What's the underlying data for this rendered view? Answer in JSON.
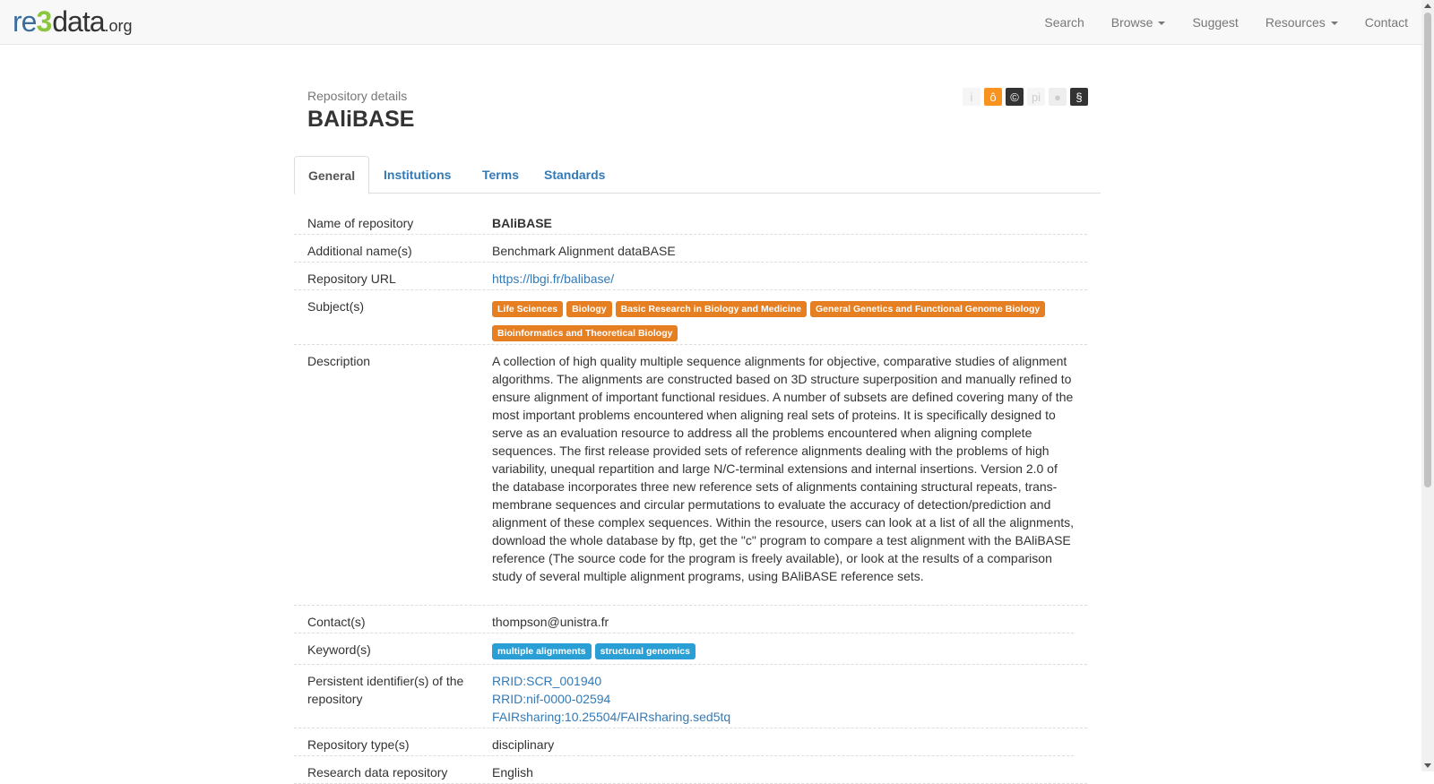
{
  "navbar": {
    "logo": {
      "re": "re",
      "three": "3",
      "data": "data",
      "org": ".org"
    },
    "links": [
      {
        "label": "Search",
        "dropdown": false
      },
      {
        "label": "Browse",
        "dropdown": true
      },
      {
        "label": "Suggest",
        "dropdown": false
      },
      {
        "label": "Resources",
        "dropdown": true
      },
      {
        "label": "Contact",
        "dropdown": false
      }
    ]
  },
  "header": {
    "subtitle": "Repository details",
    "title": "BAliBASE",
    "badges": [
      {
        "name": "info-icon",
        "glyph": "i",
        "bg": "#f5f5f5",
        "fg": "#cccccc"
      },
      {
        "name": "open-access-icon",
        "glyph": "ô",
        "bg": "#f7931e",
        "fg": "#ffffff"
      },
      {
        "name": "copyright-icon",
        "glyph": "©",
        "bg": "#333333",
        "fg": "#ffffff"
      },
      {
        "name": "pid-icon",
        "glyph": "pi",
        "bg": "#f5f5f5",
        "fg": "#cccccc"
      },
      {
        "name": "certificate-icon",
        "glyph": "●",
        "bg": "#eeeeee",
        "fg": "#cccccc"
      },
      {
        "name": "policy-icon",
        "glyph": "§",
        "bg": "#333333",
        "fg": "#ffffff"
      }
    ]
  },
  "tabs": [
    "General",
    "Institutions",
    "Terms",
    "Standards"
  ],
  "details": {
    "name": {
      "label": "Name of repository",
      "value": "BAliBASE"
    },
    "additional": {
      "label": "Additional name(s)",
      "value": "Benchmark Alignment dataBASE"
    },
    "url": {
      "label": "Repository URL",
      "value": "https://lbgi.fr/balibase/"
    },
    "subjects": {
      "label": "Subject(s)",
      "tags": [
        "Life Sciences",
        "Biology",
        "Basic Research in Biology and Medicine",
        "General Genetics and Functional Genome Biology",
        "Bioinformatics and Theoretical Biology"
      ]
    },
    "description": {
      "label": "Description",
      "value": "A collection of high quality multiple sequence alignments for objective, comparative studies of alignment algorithms. The alignments are constructed based on 3D structure superposition and manually refined to ensure alignment of important functional residues. A number of subsets are defined covering many of the most important problems encountered when aligning real sets of proteins. It is specifically designed to serve as an evaluation resource to address all the problems encountered when aligning complete sequences. The first release provided sets of reference alignments dealing with the problems of high variability, unequal repartition and large N/C-terminal extensions and internal insertions. Version 2.0 of the database incorporates three new reference sets of alignments containing structural repeats, trans-membrane sequences and circular permutations to evaluate the accuracy of detection/prediction and alignment of these complex sequences. Within the resource, users can look at a list of all the alignments, download the whole database by ftp, get the \"c\" program to compare a test alignment with the BAliBASE reference (The source code for the program is freely available), or look at the results of a comparison study of several multiple alignment programs, using BAliBASE reference sets."
    },
    "contacts": {
      "label": "Contact(s)",
      "value": "thompson@unistra.fr"
    },
    "keywords": {
      "label": "Keyword(s)",
      "tags": [
        "multiple alignments",
        "structural genomics"
      ]
    },
    "pids": {
      "label": "Persistent identifier(s) of the repository",
      "items": [
        "RRID:SCR_001940",
        "RRID:nif-0000-02594",
        "FAIRsharing:10.25504/FAIRsharing.sed5tq"
      ]
    },
    "type": {
      "label": "Repository type(s)",
      "value": "disciplinary"
    },
    "language": {
      "label": "Research data repository",
      "value": "English"
    }
  },
  "colors": {
    "link": "#337ab7",
    "subject_tag": "#e67e22",
    "keyword_tag": "#2a9fd6"
  }
}
